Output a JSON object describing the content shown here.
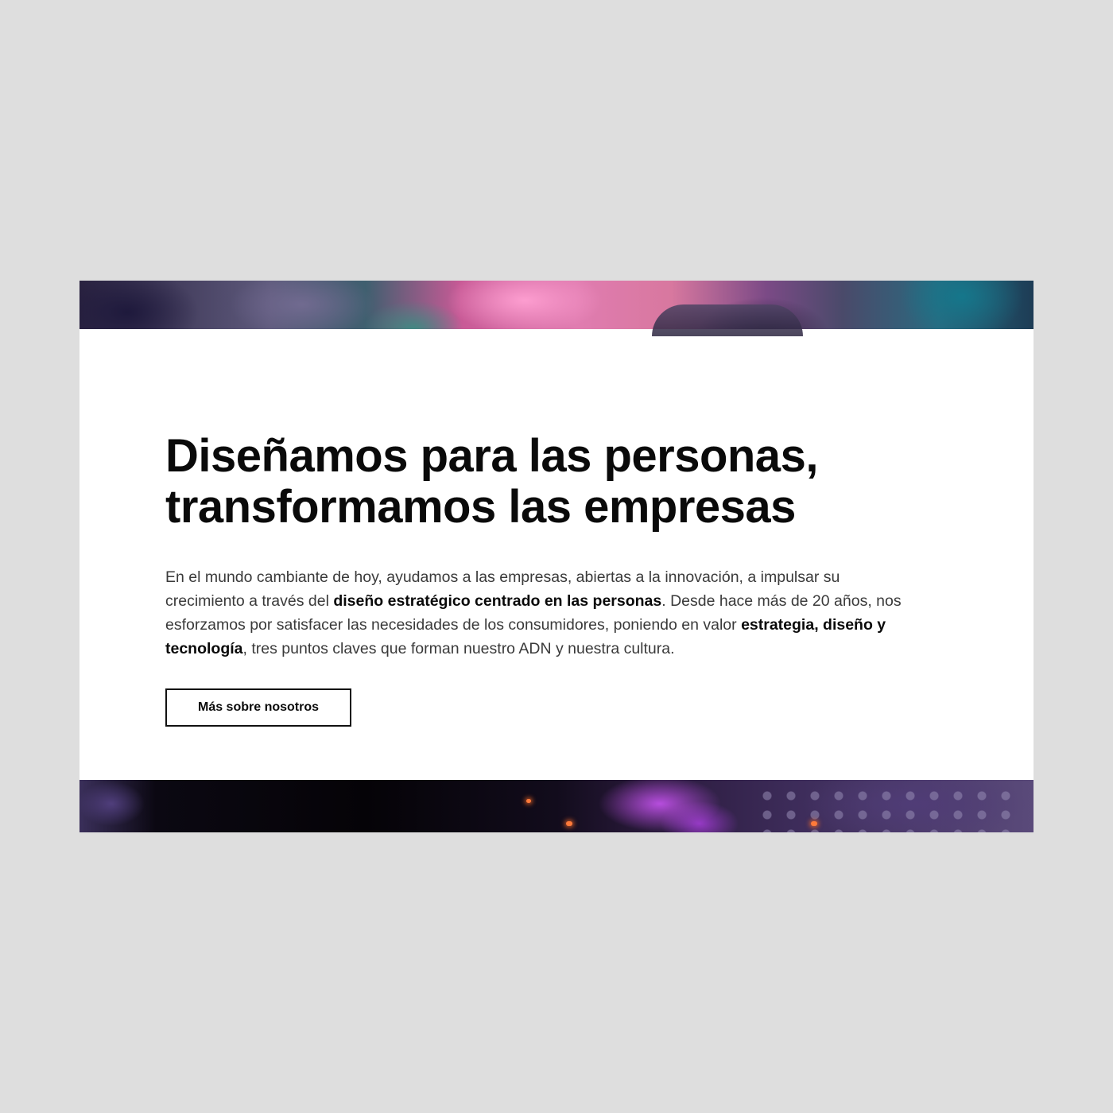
{
  "hero": {
    "headline_line1": "Diseñamos para las personas,",
    "headline_line2": "transformamos las empresas",
    "body": {
      "l1": "En el mundo cambiante de hoy, ayudamos a las empresas, abiertas a la innovación, a impulsar su",
      "l2a": "crecimiento a través del ",
      "l2b": "diseño estratégico centrado en las personas",
      "l2c": ". Desde hace más de 20 años, nos",
      "l3a": "esforzamos por satisfacer las necesidades de los consumidores, poniendo en valor ",
      "l3b": "estrategia, diseño y",
      "l4a": "tecnología",
      "l4b": ", tres puntos claves que forman nuestro ADN y nuestra cultura."
    },
    "cta_label": "Más sobre nosotros"
  },
  "colors": {
    "page_background": "#dedede",
    "card_background": "#ffffff",
    "text_primary": "#0a0a0a",
    "text_body": "#3a3a3a"
  }
}
